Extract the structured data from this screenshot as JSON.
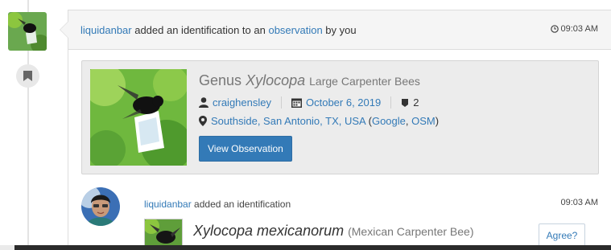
{
  "header": {
    "user": "liquidanbar",
    "text_before_link": " added an identification to an ",
    "link_text": "observation",
    "text_after_link": " by you",
    "time": "09:03 AM"
  },
  "observation": {
    "rank": "Genus",
    "taxon_name": "Xylocopa",
    "common_name": "Large Carpenter Bees",
    "user": "craighensley",
    "date": "October 6, 2019",
    "id_count": "2",
    "place": "Southside, San Antonio, TX, USA",
    "map_open": " (",
    "google_link": "Google",
    "map_sep": ", ",
    "osm_link": "OSM",
    "map_close": ")",
    "view_button": "View Observation"
  },
  "identification": {
    "user": "liquidanbar",
    "text": " added an identification",
    "time": "09:03 AM",
    "taxon_name": "Xylocopa mexicanorum",
    "common_name": "(Mexican Carpenter Bee)",
    "agree_button": "Agree?"
  },
  "colors": {
    "link": "#337ab7",
    "button": "#337ab7",
    "panel": "#ececec"
  },
  "icons": [
    "bookmark-icon",
    "clock-icon",
    "user-icon",
    "calendar-icon",
    "id-badge-icon",
    "map-marker-icon"
  ]
}
